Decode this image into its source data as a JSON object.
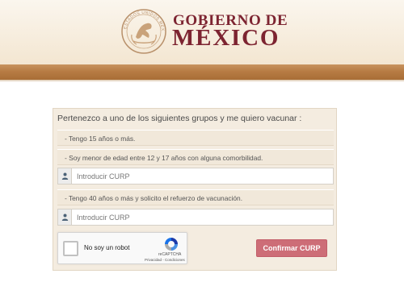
{
  "header": {
    "seal_text": "ESTADOS UNIDOS MEXICANOS",
    "logo_line1": "GOBIERNO DE",
    "logo_line2": "MÉXICO",
    "colors": {
      "brand": "#7d2431",
      "band": "#b77c44"
    }
  },
  "panel": {
    "title": "Pertenezco a uno de los siguientes grupos y me quiero vacunar :",
    "options": [
      "- Tengo 15 años o más.",
      "- Soy menor de edad entre 12 y 17 años con alguna comorbilidad.",
      "- Tengo 40 años o más y solicito el refuerzo de vacunación."
    ],
    "curp_placeholder": "Introducir CURP",
    "curp_icon": "user-icon"
  },
  "captcha": {
    "label": "No soy un robot",
    "brand": "reCAPTCHA",
    "terms": "Privacidad - Condiciones"
  },
  "confirm_label": "Confirmar CURP",
  "colors": {
    "confirm": "#cd6d77"
  }
}
